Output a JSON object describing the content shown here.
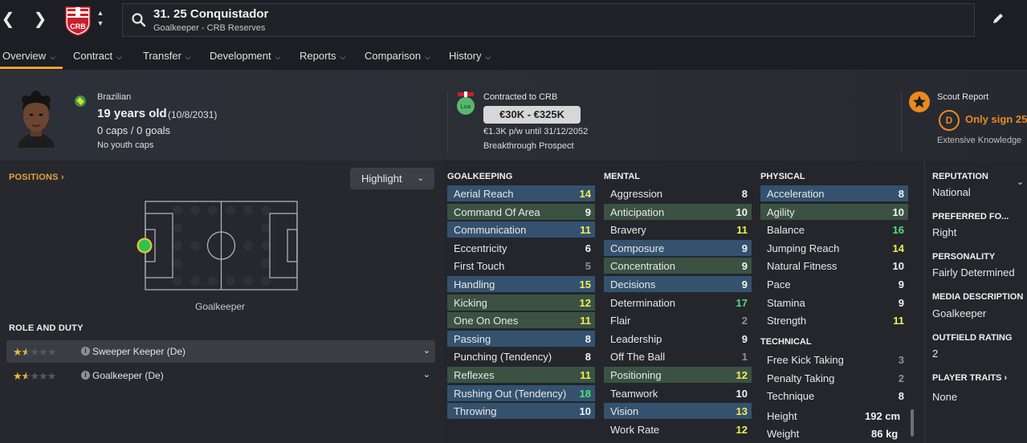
{
  "header": {
    "player_name": "31. 25 Conquistador",
    "player_subtitle": "Goalkeeper - CRB Reserves",
    "club_crest": "CRB"
  },
  "tabs": [
    {
      "label": "Overview"
    },
    {
      "label": "Contract"
    },
    {
      "label": "Transfer"
    },
    {
      "label": "Development"
    },
    {
      "label": "Reports"
    },
    {
      "label": "Comparison"
    },
    {
      "label": "History"
    }
  ],
  "info": {
    "nationality": "Brazilian",
    "age": "19 years old",
    "dob": "(10/8/2031)",
    "caps": "0 caps / 0 goals",
    "youth_caps": "No youth caps",
    "contract_status": "Contracted to CRB",
    "loan_badge": "Loa",
    "value_range": "€30K - €325K",
    "wage": "€1.3K p/w until 31/12/2052",
    "prospect": "Breakthrough Prospect",
    "scout_title": "Scout Report",
    "scout_grade": "D",
    "scout_verdict": "Only sign 25",
    "scout_knowledge": "Extensive Knowledge"
  },
  "positions": {
    "title": "POSITIONS",
    "highlight_label": "Highlight",
    "position_label": "Goalkeeper"
  },
  "roles": {
    "title": "ROLE AND DUTY",
    "items": [
      {
        "name": "Sweeper Keeper (De)",
        "stars": 1.5
      },
      {
        "name": "Goalkeeper (De)",
        "stars": 1.5
      }
    ]
  },
  "goalkeeping": {
    "title": "GOALKEEPING",
    "items": [
      {
        "name": "Aerial Reach",
        "value": "14"
      },
      {
        "name": "Command Of Area",
        "value": "9"
      },
      {
        "name": "Communication",
        "value": "11"
      },
      {
        "name": "Eccentricity",
        "value": "6"
      },
      {
        "name": "First Touch",
        "value": "5"
      },
      {
        "name": "Handling",
        "value": "15"
      },
      {
        "name": "Kicking",
        "value": "12"
      },
      {
        "name": "One On Ones",
        "value": "11"
      },
      {
        "name": "Passing",
        "value": "8"
      },
      {
        "name": "Punching (Tendency)",
        "value": "8"
      },
      {
        "name": "Reflexes",
        "value": "11"
      },
      {
        "name": "Rushing Out (Tendency)",
        "value": "18"
      },
      {
        "name": "Throwing",
        "value": "10"
      }
    ]
  },
  "mental": {
    "title": "MENTAL",
    "items": [
      {
        "name": "Aggression",
        "value": "8"
      },
      {
        "name": "Anticipation",
        "value": "10"
      },
      {
        "name": "Bravery",
        "value": "11"
      },
      {
        "name": "Composure",
        "value": "9"
      },
      {
        "name": "Concentration",
        "value": "9"
      },
      {
        "name": "Decisions",
        "value": "9"
      },
      {
        "name": "Determination",
        "value": "17"
      },
      {
        "name": "Flair",
        "value": "2"
      },
      {
        "name": "Leadership",
        "value": "9"
      },
      {
        "name": "Off The Ball",
        "value": "1"
      },
      {
        "name": "Positioning",
        "value": "12"
      },
      {
        "name": "Teamwork",
        "value": "10"
      },
      {
        "name": "Vision",
        "value": "13"
      },
      {
        "name": "Work Rate",
        "value": "12"
      }
    ]
  },
  "physical": {
    "title": "PHYSICAL",
    "items": [
      {
        "name": "Acceleration",
        "value": "8"
      },
      {
        "name": "Agility",
        "value": "10"
      },
      {
        "name": "Balance",
        "value": "16"
      },
      {
        "name": "Jumping Reach",
        "value": "14"
      },
      {
        "name": "Natural Fitness",
        "value": "10"
      },
      {
        "name": "Pace",
        "value": "9"
      },
      {
        "name": "Stamina",
        "value": "9"
      },
      {
        "name": "Strength",
        "value": "11"
      }
    ]
  },
  "technical": {
    "title": "TECHNICAL",
    "items": [
      {
        "name": "Free Kick Taking",
        "value": "3"
      },
      {
        "name": "Penalty Taking",
        "value": "2"
      },
      {
        "name": "Technique",
        "value": "8"
      }
    ]
  },
  "body": {
    "height_label": "Height",
    "height_value": "192 cm",
    "weight_label": "Weight",
    "weight_value": "86 kg"
  },
  "side": {
    "reputation_title": "REPUTATION",
    "reputation_value": "National",
    "foot_title": "PREFERRED FO...",
    "foot_value": "Right",
    "personality_title": "PERSONALITY",
    "personality_value": "Fairly Determined",
    "media_title": "MEDIA DESCRIPTION",
    "media_value": "Goalkeeper",
    "outfield_title": "OUTFIELD RATING",
    "outfield_value": "2",
    "traits_title": "PLAYER TRAITS",
    "traits_value": "None"
  },
  "colors": {
    "accent": "#e8a23a",
    "scout_orange": "#e98a1f",
    "highlight_blue": "#34526e",
    "highlight_green": "#3b5243",
    "value_good": "#f1ee56",
    "value_great": "#52e07a",
    "value_low": "#8d9099"
  }
}
